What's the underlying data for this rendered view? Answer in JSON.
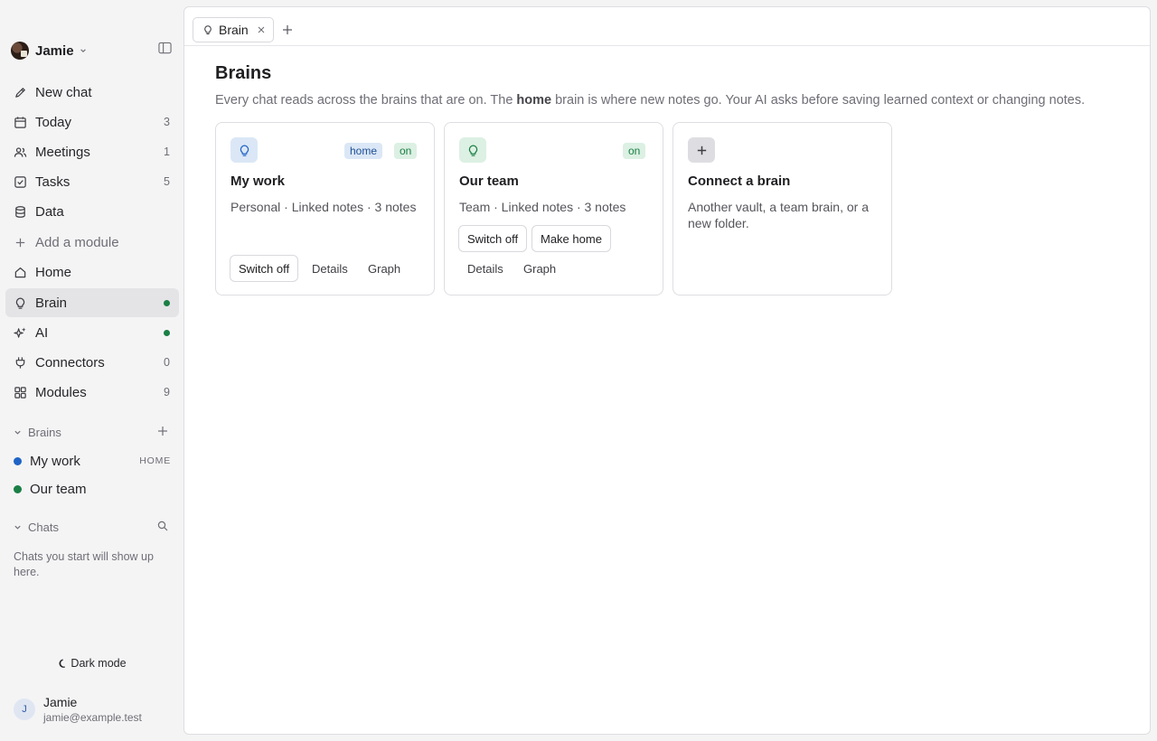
{
  "workspace": {
    "name": "Jamie"
  },
  "nav": {
    "items": [
      {
        "label": "New chat",
        "count": "",
        "dot": false
      },
      {
        "label": "Today",
        "count": "3",
        "dot": false
      },
      {
        "label": "Meetings",
        "count": "1",
        "dot": false
      },
      {
        "label": "Tasks",
        "count": "5",
        "dot": false
      },
      {
        "label": "Data",
        "count": "",
        "dot": false
      },
      {
        "label": "Add a module",
        "count": "",
        "dot": false
      },
      {
        "label": "Home",
        "count": "",
        "dot": false
      },
      {
        "label": "Brain",
        "count": "",
        "dot": true,
        "active": true
      },
      {
        "label": "AI",
        "count": "",
        "dot": true
      },
      {
        "label": "Connectors",
        "count": "0",
        "dot": false
      },
      {
        "label": "Modules",
        "count": "9",
        "dot": false
      }
    ]
  },
  "sidebar_brains": {
    "header": "Brains",
    "items": [
      {
        "label": "My work",
        "tag": "HOME",
        "color": "#1f63c6"
      },
      {
        "label": "Our team",
        "tag": "",
        "color": "#1a7f45"
      }
    ]
  },
  "sidebar_chats": {
    "header": "Chats",
    "empty_text": "Chats you start will show up here."
  },
  "dark_mode_label": "Dark mode",
  "user": {
    "initial": "J",
    "name": "Jamie",
    "email": "jamie@example.test"
  },
  "tabs": [
    {
      "label": "Brain",
      "icon": "lightbulb-icon"
    }
  ],
  "page": {
    "title": "Brains",
    "desc_pre": "Every chat reads across the brains that are on. The ",
    "desc_bold": "home",
    "desc_post": " brain is where new notes go. Your AI asks before saving learned context or changing notes."
  },
  "cards": [
    {
      "title": "My work",
      "meta": "Personal · Linked notes · 3 notes",
      "badges": [
        "home",
        "on"
      ],
      "buttons": {
        "switch": "Switch off",
        "details": "Details",
        "graph": "Graph"
      }
    },
    {
      "title": "Our team",
      "meta": "Team · Linked notes · 3 notes",
      "badges": [
        "on"
      ],
      "buttons": {
        "switch": "Switch off",
        "make_home": "Make home",
        "details": "Details",
        "graph": "Graph"
      }
    },
    {
      "title": "Connect a brain",
      "meta": "Another vault, a team brain, or a new folder."
    }
  ],
  "colors": {
    "accent_green": "#1a7f45",
    "accent_blue": "#1f63c6",
    "active_bg": "#e4e4e7"
  }
}
